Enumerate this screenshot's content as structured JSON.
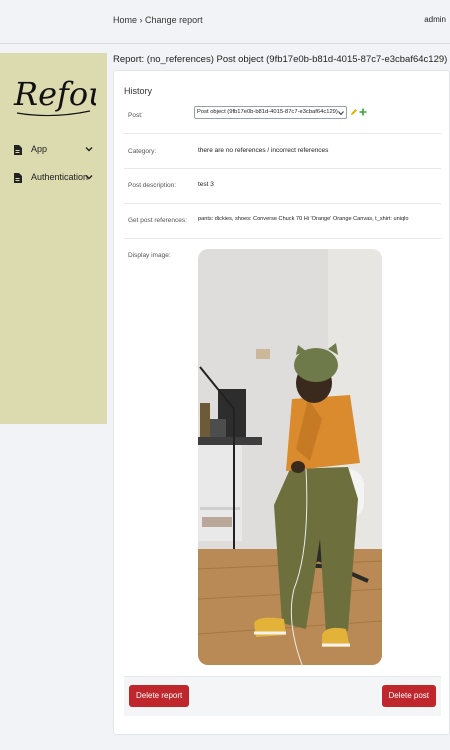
{
  "header": {
    "breadcrumb_home": "Home",
    "breadcrumb_separator": "›",
    "breadcrumb_current": "Change report",
    "user_label": "admin"
  },
  "sidebar": {
    "logo_text": "Refout",
    "items": [
      {
        "label": "App",
        "icon": "document-icon"
      },
      {
        "label": "Authentication",
        "icon": "document-icon"
      }
    ]
  },
  "page": {
    "title": "Report: (no_references) Post object (9fb17e0b-b81d-4015-87c7-e3cbaf64c129)"
  },
  "form": {
    "fieldset_title": "History",
    "post_label": "Post:",
    "post_selected": "Post object (9fb17e0b-b81d-4015-87c7-e3cbaf64c129)",
    "category_label": "Category:",
    "category_value": "there are no references / incorrect references",
    "description_label": "Post description:",
    "description_value": "test 3",
    "references_label": "Get post references:",
    "references_value": "pants: dickies, shoes: Converse Chuck 70 Hi 'Orange' Orange Canvas, t_shirt: uniqlo",
    "image_label": "Display image:"
  },
  "actions": {
    "delete_report": "Delete report",
    "delete_post": "Delete post"
  },
  "colors": {
    "sidebar_bg": "#dcdbb0",
    "danger": "#c0272d",
    "page_bg": "#f1f3f6"
  }
}
